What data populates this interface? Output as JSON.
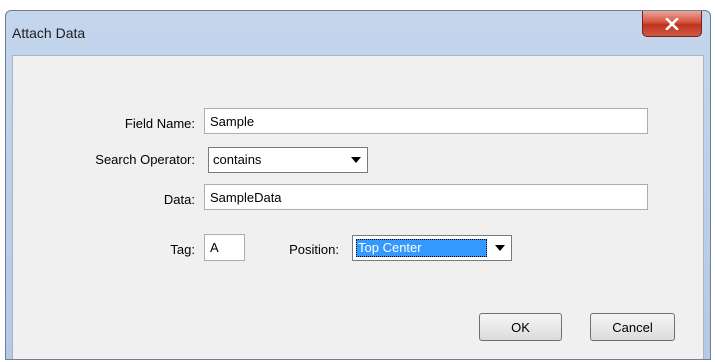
{
  "window": {
    "title": "Attach Data",
    "close_icon": "close-icon"
  },
  "form": {
    "field_name": {
      "label": "Field Name:",
      "value": "Sample"
    },
    "search_operator": {
      "label": "Search Operator:",
      "value": "contains"
    },
    "data": {
      "label": "Data:",
      "value": "SampleData"
    },
    "tag": {
      "label": "Tag:",
      "value": "A"
    },
    "position": {
      "label": "Position:",
      "value": "Top Center"
    }
  },
  "buttons": {
    "ok": "OK",
    "cancel": "Cancel"
  },
  "colors": {
    "selection": "#3399ff",
    "close_button": "#c8432f",
    "frame": "#b9cde8"
  }
}
